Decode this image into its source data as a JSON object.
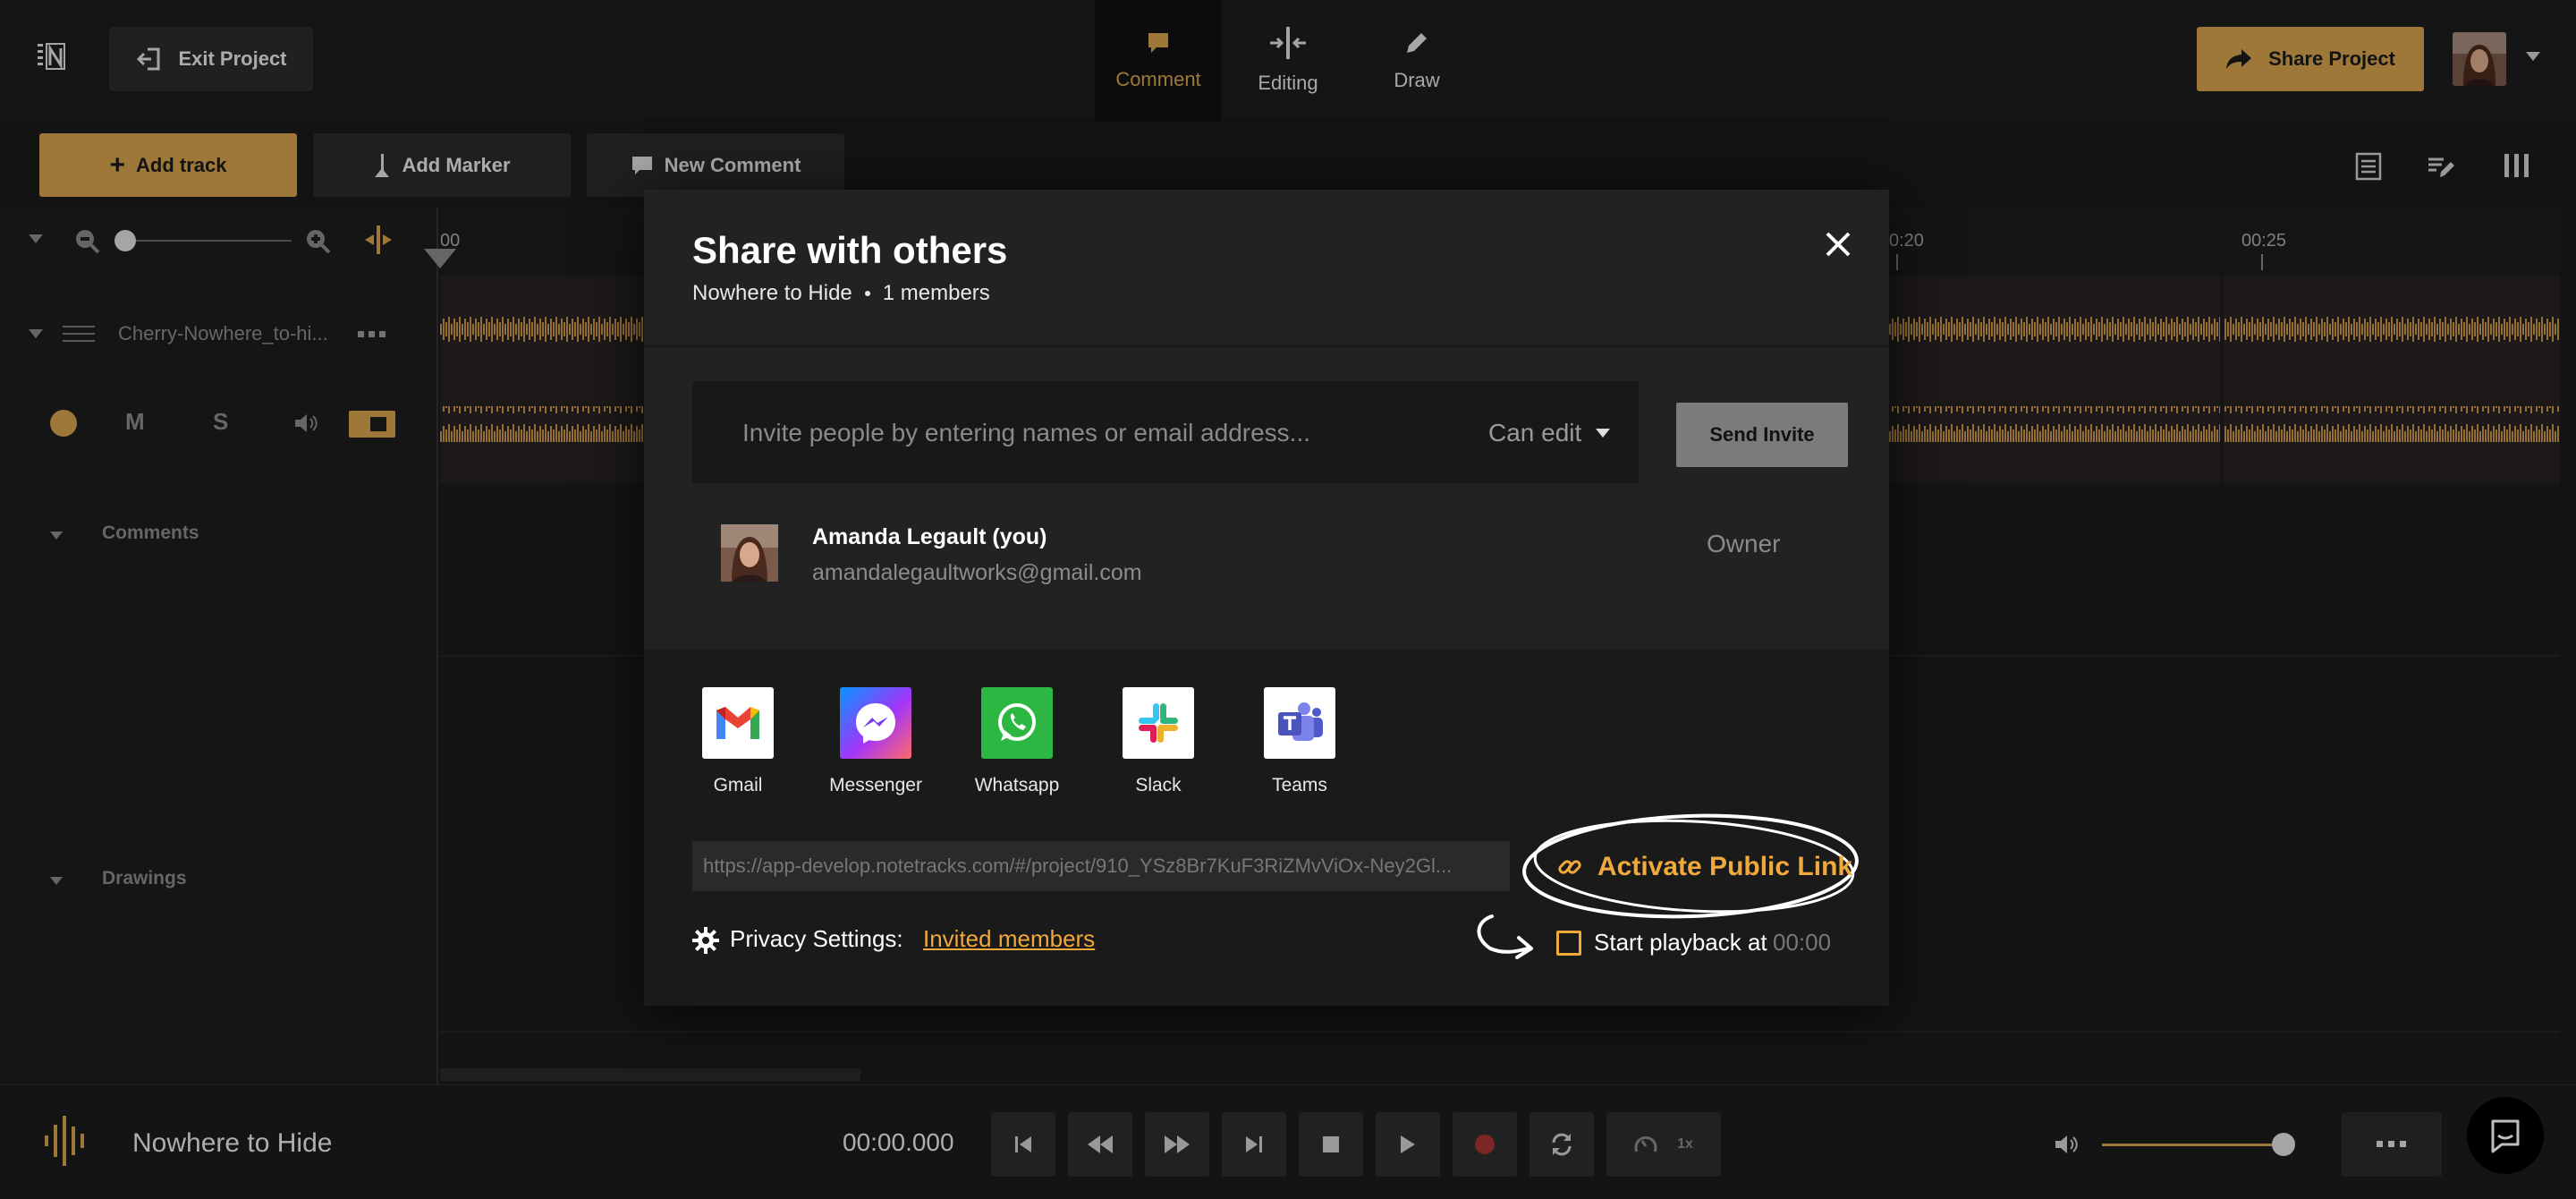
{
  "header": {
    "exit_label": "Exit Project",
    "modes": [
      {
        "label": "Comment",
        "active": true
      },
      {
        "label": "Editing",
        "active": false
      },
      {
        "label": "Draw",
        "active": false
      }
    ],
    "share_label": "Share Project"
  },
  "toolbar": {
    "add_track": "Add track",
    "add_marker": "Add Marker",
    "new_comment": "New Comment"
  },
  "timeline": {
    "tick_start": "00",
    "tick_20": "0:20",
    "tick_25": "00:25"
  },
  "track": {
    "name": "Cherry-Nowhere_to-hi...",
    "mute": "M",
    "solo": "S"
  },
  "sections": {
    "comments": "Comments",
    "drawings": "Drawings"
  },
  "modal": {
    "title": "Share with others",
    "project_name": "Nowhere to Hide",
    "members": "1 members",
    "invite_placeholder": "Invite people by entering names or email address...",
    "permission": "Can edit",
    "send_label": "Send Invite",
    "member": {
      "name": "Amanda Legault (you)",
      "email": "amandalegaultworks@gmail.com",
      "role": "Owner"
    },
    "apps": [
      "Gmail",
      "Messenger",
      "Whatsapp",
      "Slack",
      "Teams"
    ],
    "link_url": "https://app-develop.notetracks.com/#/project/910_YSz8Br7KuF3RiZMvViOx-Ney2Gl...",
    "activate_label": "Activate Public Link",
    "privacy_label": "Privacy Settings:",
    "privacy_value": "Invited members",
    "playback_label": "Start playback at",
    "playback_time": "00:00"
  },
  "footer": {
    "project_title": "Nowhere to Hide",
    "time": "00:00.000",
    "speed": "1x"
  },
  "colors": {
    "accent": "#d3a04b",
    "link_orange": "#f0a93a"
  }
}
